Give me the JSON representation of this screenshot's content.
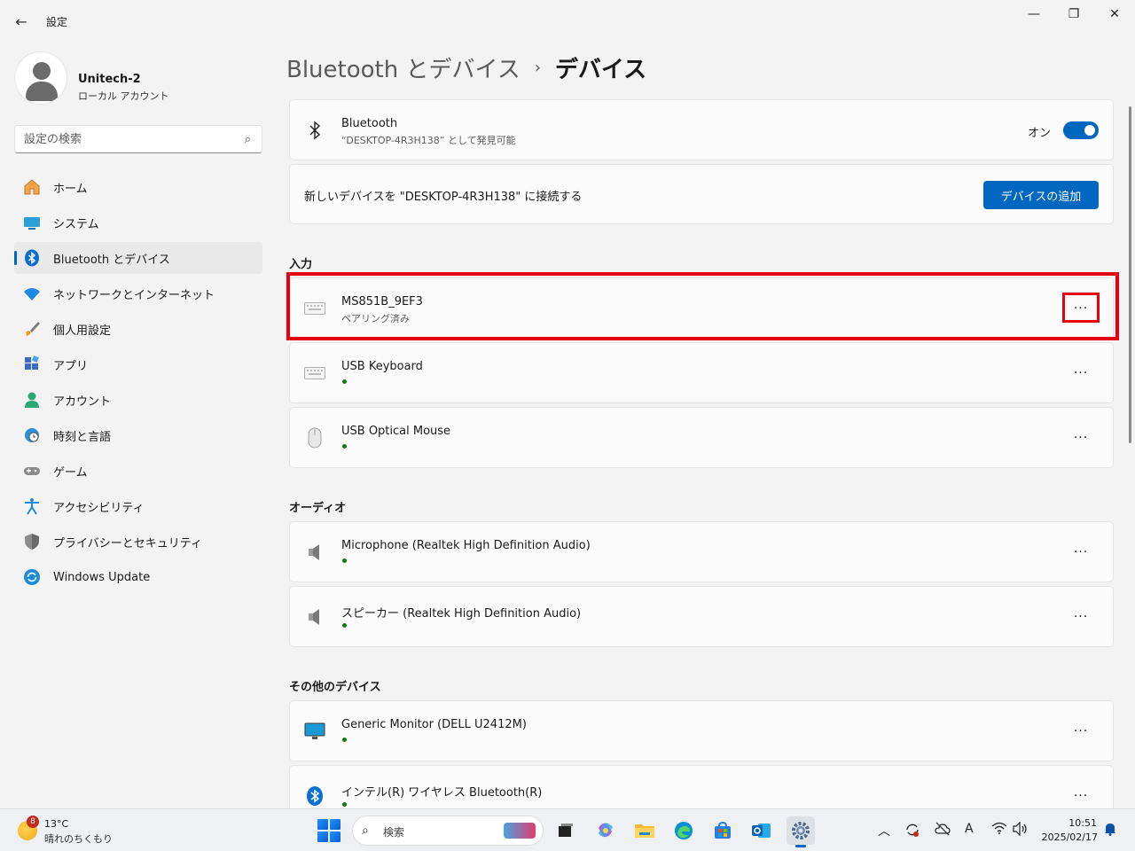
{
  "window": {
    "title": "設定",
    "back_icon": "←",
    "minimize_icon": "—",
    "maximize_icon": "❐",
    "close_icon": "✕"
  },
  "profile": {
    "name": "Unitech-2",
    "account_type": "ローカル アカウント"
  },
  "search": {
    "placeholder": "設定の検索",
    "icon": "⌕"
  },
  "sidebar": {
    "items": [
      {
        "label": "ホーム",
        "icon": "home-icon"
      },
      {
        "label": "システム",
        "icon": "system-icon"
      },
      {
        "label": "Bluetooth とデバイス",
        "icon": "bluetooth-icon",
        "active": true
      },
      {
        "label": "ネットワークとインターネット",
        "icon": "wifi-icon"
      },
      {
        "label": "個人用設定",
        "icon": "brush-icon"
      },
      {
        "label": "アプリ",
        "icon": "apps-icon"
      },
      {
        "label": "アカウント",
        "icon": "account-icon"
      },
      {
        "label": "時刻と言語",
        "icon": "clock-globe-icon"
      },
      {
        "label": "ゲーム",
        "icon": "gamepad-icon"
      },
      {
        "label": "アクセシビリティ",
        "icon": "accessibility-icon"
      },
      {
        "label": "プライバシーとセキュリティ",
        "icon": "shield-icon"
      },
      {
        "label": "Windows Update",
        "icon": "update-icon"
      }
    ]
  },
  "breadcrumb": {
    "parent": "Bluetooth とデバイス",
    "separator": "›",
    "current": "デバイス"
  },
  "bluetooth_card": {
    "title": "Bluetooth",
    "subtitle": "“DESKTOP-4R3H138” として発見可能",
    "toggle_label": "オン",
    "toggle_on": true
  },
  "add_device_card": {
    "text": "新しいデバイスを \"DESKTOP-4R3H138\" に接続する",
    "button_label": "デバイスの追加"
  },
  "sections": {
    "input": "入力",
    "audio": "オーディオ",
    "other": "その他のデバイス"
  },
  "devices": {
    "input": [
      {
        "name": "MS851B_9EF3",
        "status": "ペアリング済み",
        "icon": "keyboard-icon"
      },
      {
        "name": "USB Keyboard",
        "status_dot": true,
        "icon": "keyboard-icon"
      },
      {
        "name": "USB Optical Mouse",
        "status_dot": true,
        "icon": "mouse-icon"
      }
    ],
    "audio": [
      {
        "name": "Microphone (Realtek High Definition Audio)",
        "status_dot": true,
        "icon": "speaker-icon"
      },
      {
        "name": "スピーカー (Realtek High Definition Audio)",
        "status_dot": true,
        "icon": "speaker-icon"
      }
    ],
    "other": [
      {
        "name": "Generic Monitor (DELL U2412M)",
        "status_dot": true,
        "icon": "monitor-icon"
      },
      {
        "name": "インテル(R) ワイヤレス Bluetooth(R)",
        "status_dot": true,
        "icon": "bluetooth-icon"
      }
    ]
  },
  "more_label": "···",
  "colors": {
    "accent": "#0067c0",
    "highlight": "#e60012",
    "status_green": "#0f7b0f"
  },
  "taskbar": {
    "weather_badge": "8",
    "weather_temp": "13°C",
    "weather_desc": "晴れのちくもり",
    "search_label": "検索",
    "tray_chevron": "︿",
    "tray_ime": "A",
    "time": "10:51",
    "date": "2025/02/17"
  }
}
